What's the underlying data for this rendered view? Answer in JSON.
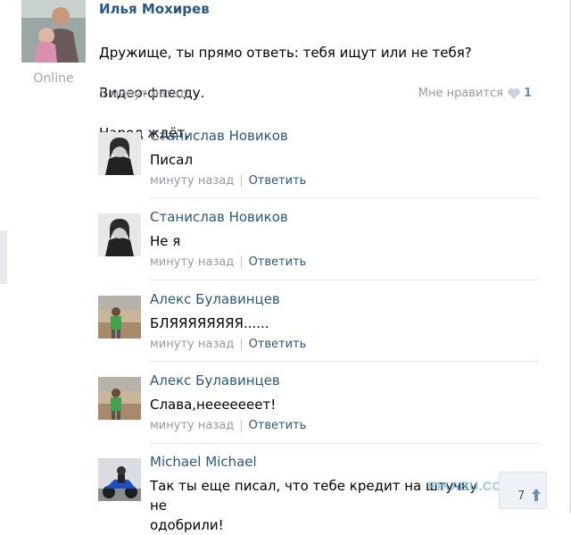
{
  "post": {
    "author": "Илья Мохирев",
    "status": "Online",
    "text_lines": [
      "Дружище, ты прямо ответь: тебя ищут или не тебя?",
      "Видео-фпесду.",
      "Народ ждёт."
    ],
    "time": "5 минут назад",
    "like_label": "Мне нравится",
    "like_count": "1",
    "heart_icon": "heart-icon"
  },
  "comments": [
    {
      "name": "Станислав Новиков",
      "text": "Писал",
      "time": "минуту назад",
      "reply": "Ответить",
      "sep": "|"
    },
    {
      "name": "Станислав Новиков",
      "text": "Не я",
      "time": "минуту назад",
      "reply": "Ответить",
      "sep": "|"
    },
    {
      "name": "Алекс Булавинцев",
      "text": "БЛЯЯЯЯЯЯЯЯ......",
      "time": "минуту назад",
      "reply": "Ответить",
      "sep": "|"
    },
    {
      "name": "Алекс Булавинцев",
      "text": "Слава,нееееееет!",
      "time": "минуту назад",
      "reply": "Ответить",
      "sep": "|"
    },
    {
      "name": "Michael Michael",
      "text": "Так ты еще писал, что тебе кредит на штучку не\nодобрили!"
    }
  ],
  "watermark": "PIKABU.COM",
  "corner_count": "7",
  "colors": {
    "link": "#2a5885",
    "meta": "#939ba5",
    "divider": "#e5e9ee",
    "background": "#ffffff"
  }
}
